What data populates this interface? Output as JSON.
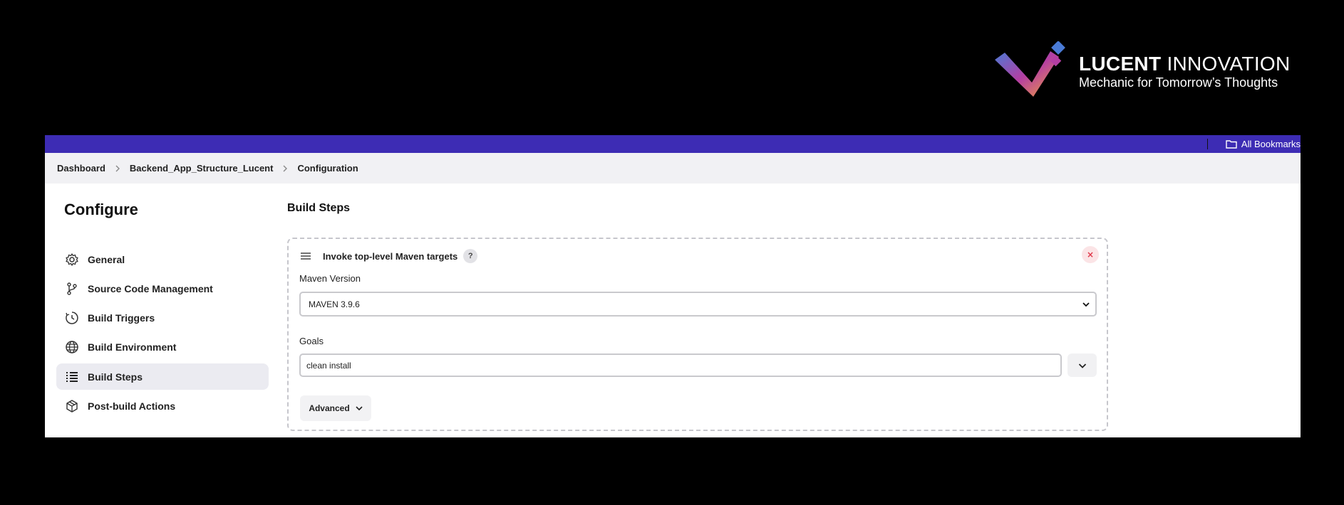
{
  "brand": {
    "name_bold": "LUCENT",
    "name_rest": " INNOVATION",
    "tagline": "Mechanic for Tomorrow’s Thoughts"
  },
  "topbar": {
    "bookmarks_label": "All Bookmarks"
  },
  "breadcrumb": [
    "Dashboard",
    "Backend_App_Structure_Lucent",
    "Configuration"
  ],
  "sidebar": {
    "title": "Configure",
    "items": [
      {
        "label": "General",
        "icon": "gear-icon",
        "active": false
      },
      {
        "label": "Source Code Management",
        "icon": "branch-icon",
        "active": false
      },
      {
        "label": "Build Triggers",
        "icon": "clock-icon",
        "active": false
      },
      {
        "label": "Build Environment",
        "icon": "globe-icon",
        "active": false
      },
      {
        "label": "Build Steps",
        "icon": "list-icon",
        "active": true
      },
      {
        "label": "Post-build Actions",
        "icon": "package-icon",
        "active": false
      }
    ]
  },
  "main": {
    "section_title": "Build Steps",
    "step": {
      "title": "Invoke top-level Maven targets",
      "help_label": "?",
      "close_label": "×",
      "maven_version_label": "Maven Version",
      "maven_version_value": "MAVEN 3.9.6",
      "goals_label": "Goals",
      "goals_value": "clean install",
      "advanced_label": "Advanced"
    }
  },
  "colors": {
    "topbar": "#3d2cb4",
    "active_nav": "#ebebf1",
    "close_red": "#e0384a"
  }
}
